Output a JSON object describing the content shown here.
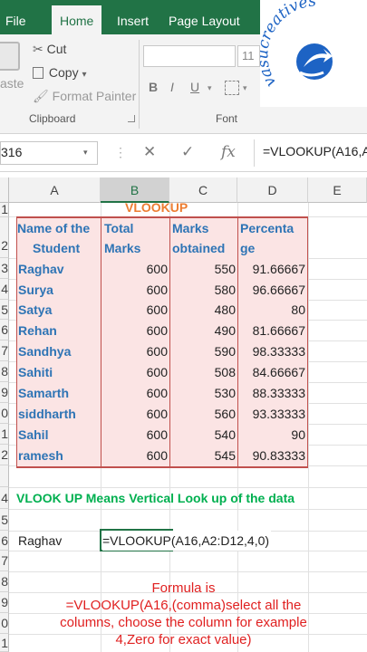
{
  "tabs": [
    {
      "label": "File",
      "active": false
    },
    {
      "label": "Home",
      "active": true
    },
    {
      "label": "Insert",
      "active": false
    },
    {
      "label": "Page Layout",
      "active": false
    }
  ],
  "ribbon": {
    "paste_label": "aste",
    "cut_label": "Cut",
    "copy_label": "Copy",
    "format_painter_label": "Format Painter",
    "clipboard_group": "Clipboard",
    "font_group": "Font",
    "font_size": "11",
    "bold": "B",
    "italic": "I",
    "underline": "U"
  },
  "logo_text": "vasucreatives",
  "formula_bar": {
    "name_box": "316",
    "fx": "fx",
    "formula": "=VLOOKUP(A16,A"
  },
  "columns": [
    "A",
    "B",
    "C",
    "D",
    "E"
  ],
  "row_numbers": [
    "1",
    "2",
    "3",
    "4",
    "5",
    "6",
    "7",
    "8",
    "9",
    "0",
    "1",
    "2",
    "",
    "4",
    "5",
    "6",
    "7",
    "8",
    "9",
    "0",
    "1"
  ],
  "sheet": {
    "title": "VLOOKUP",
    "headers": [
      [
        "Name of the",
        "Student"
      ],
      [
        "Total",
        "Marks"
      ],
      [
        "Marks",
        "obtained"
      ],
      [
        "Percenta",
        "ge"
      ]
    ],
    "rows": [
      [
        "Raghav",
        "600",
        "550",
        "91.66667"
      ],
      [
        "Surya",
        "600",
        "580",
        "96.66667"
      ],
      [
        "Satya",
        "600",
        "480",
        "80"
      ],
      [
        "Rehan",
        "600",
        "490",
        "81.66667"
      ],
      [
        "Sandhya",
        "600",
        "590",
        "98.33333"
      ],
      [
        "Sahiti",
        "600",
        "508",
        "84.66667"
      ],
      [
        "Samarth",
        "600",
        "530",
        "88.33333"
      ],
      [
        "siddharth",
        "600",
        "560",
        "93.33333"
      ],
      [
        "Sahil",
        "600",
        "540",
        "90"
      ],
      [
        "ramesh",
        "600",
        "545",
        "90.83333"
      ]
    ],
    "note": "VLOOK UP Means Vertical Look up of the data",
    "lookup_value": "Raghav",
    "lookup_formula": "=VLOOKUP(A16,A2:D12,4,0)",
    "caption_lines": [
      "Formula is",
      "=VLOOKUP(A16,(comma)select all the",
      "columns, choose the column for example",
      "4,Zero for exact value)"
    ]
  },
  "colors": {
    "excel_green": "#217346",
    "table_fill": "#fbe4e4",
    "table_border": "#c0504d",
    "header_blue": "#2e74b5",
    "title_orange": "#ed7d31",
    "note_green": "#00b050",
    "caption_red": "#e02020"
  }
}
